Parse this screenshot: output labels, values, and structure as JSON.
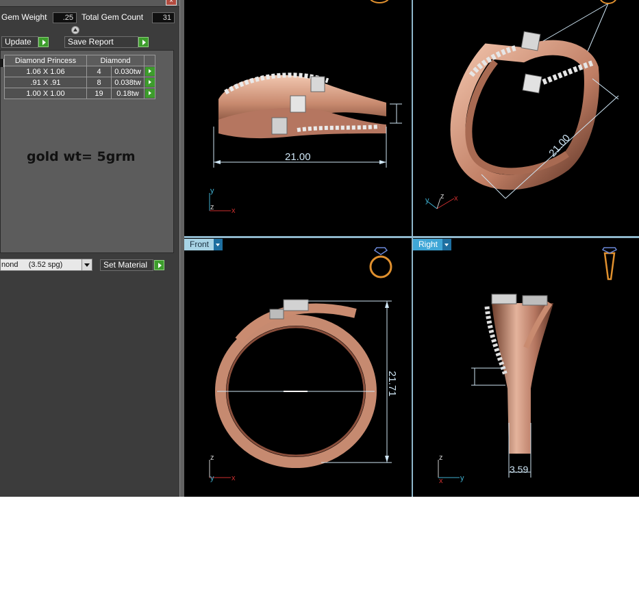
{
  "gem_props": {
    "gem_weight_label": "Gem Weight",
    "gem_weight_value": ".25",
    "total_gem_count_label": "Total Gem Count",
    "total_gem_count_value": "31"
  },
  "toolbar": {
    "update_label": "Update",
    "save_report_label": "Save Report"
  },
  "gem_table": {
    "headers": [
      "Diamond Princess",
      "Diamond"
    ],
    "rows": [
      {
        "size": "1.06 X 1.06",
        "count": "4",
        "weight": "0.030tw"
      },
      {
        "size": ".91 X .91",
        "count": "8",
        "weight": "0.038tw"
      },
      {
        "size": "1.00 X 1.00",
        "count": "19",
        "weight": "0.18tw"
      }
    ]
  },
  "note": "gold wt= 5grm",
  "material": {
    "selected": "nond     (3.52 spg)",
    "set_material_label": "Set Material"
  },
  "viewports": {
    "perspective": {
      "dimension": "21.00",
      "axes": [
        "y",
        "z",
        "x"
      ]
    },
    "iso": {
      "dimension": "21.00",
      "axes": [
        "y",
        "z",
        "x"
      ]
    },
    "front": {
      "label": "Front",
      "dimension": "21.71",
      "axes": [
        "z",
        "y",
        "x"
      ]
    },
    "right": {
      "label": "Right",
      "dimension": "3.59",
      "axes": [
        "z",
        "x",
        "y"
      ]
    }
  },
  "colors": {
    "panel_bg": "#3c3c3c",
    "accent_green": "#3d9d2c",
    "viewport_bg": "#000000",
    "rose_gold": "#c98b70",
    "label_active": "#3fa6d6"
  }
}
